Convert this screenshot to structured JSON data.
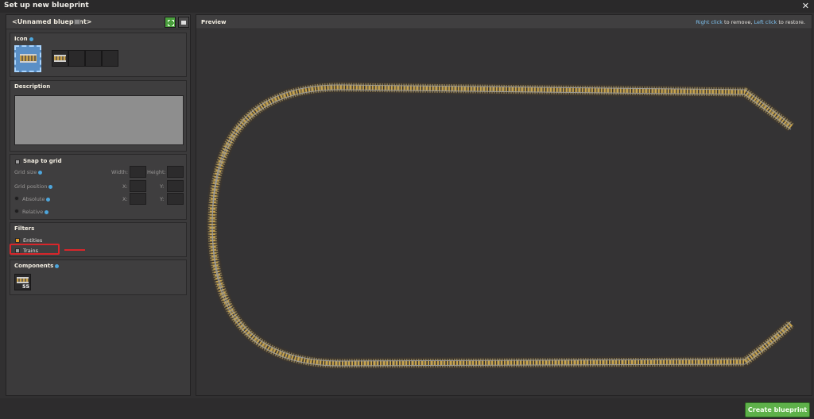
{
  "window": {
    "title": "Set up new blueprint"
  },
  "left_header": {
    "blueprint_name": "<Unnamed blueprint>"
  },
  "icon_section": {
    "label": "Icon"
  },
  "description_section": {
    "label": "Description",
    "value": ""
  },
  "snap_section": {
    "label": "Snap to grid",
    "grid_size": "Grid size",
    "width": "Width:",
    "height": "Height:",
    "grid_position": "Grid position",
    "x": "X:",
    "y": "Y:",
    "absolute": "Absolute",
    "relative": "Relative"
  },
  "filters_section": {
    "label": "Filters",
    "entities": "Entities",
    "entities_checked": true,
    "trains": "Trains",
    "trains_checked": false
  },
  "components_section": {
    "label": "Components",
    "rail_count": "55",
    "rail_icon": "rail-icon"
  },
  "preview": {
    "title": "Preview",
    "hint_right_key": "Right click",
    "hint_right_text": " to remove, ",
    "hint_left_key": "Left click",
    "hint_left_text": " to restore."
  },
  "footer": {
    "create_label": "Create blueprint"
  },
  "colors": {
    "accent_green": "#5eb14a",
    "highlight_red": "#d8262b",
    "info_blue": "#4ea6dc"
  }
}
